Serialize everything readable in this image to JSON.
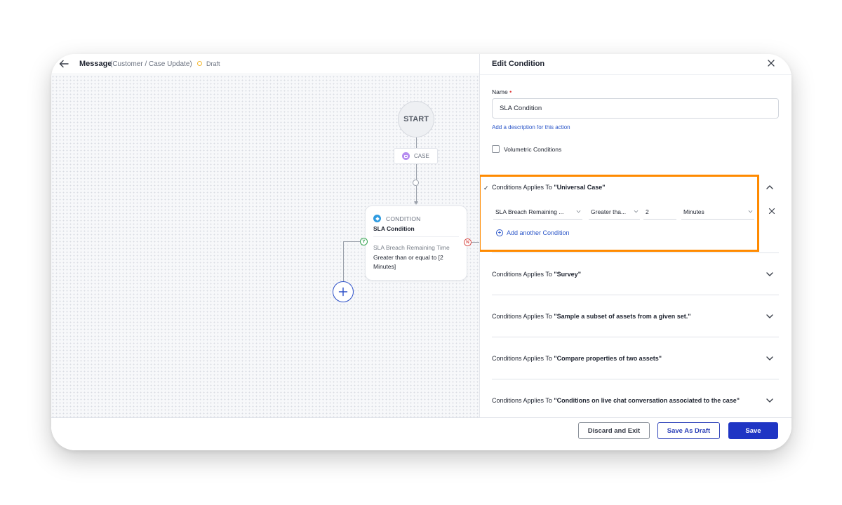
{
  "header": {
    "title": "Message",
    "subtitle": "(Customer / Case Update)",
    "status": "Draft",
    "status_color": "#f5b82e"
  },
  "canvas": {
    "start_label": "START",
    "case_label": "CASE",
    "condition_node": {
      "type": "CONDITION",
      "name": "SLA Condition",
      "field": "SLA Breach Remaining Time",
      "operator_text": "Greater than or equal to [2 Minutes]",
      "yes_label": "Y",
      "no_label": "N"
    }
  },
  "panel": {
    "title": "Edit Condition",
    "name_label": "Name",
    "name_value": "SLA Condition",
    "description_link": "Add a description for this action",
    "volumetric_label": "Volumetric Conditions",
    "volumetric_checked": false,
    "sections": [
      {
        "prefix": "Conditions Applies To ",
        "target": "\"Universal Case\"",
        "expanded": true,
        "rows": [
          {
            "field": "SLA Breach Remaining ...",
            "operator": "Greater tha...",
            "value": "2",
            "unit": "Minutes"
          }
        ],
        "add_label": "Add another Condition"
      },
      {
        "prefix": "Conditions Applies To ",
        "target": "\"Survey\"",
        "expanded": false
      },
      {
        "prefix": "Conditions Applies To ",
        "target": "\"Sample a subset of assets from a given set.\"",
        "expanded": false
      },
      {
        "prefix": "Conditions Applies To ",
        "target": "\"Compare properties of two assets\"",
        "expanded": false
      },
      {
        "prefix": "Conditions Applies To ",
        "target": "\"Conditions on live chat conversation associated to the case\"",
        "expanded": false
      }
    ]
  },
  "footer": {
    "discard_label": "Discard and Exit",
    "draft_label": "Save As Draft",
    "save_label": "Save"
  },
  "colors": {
    "primary": "#1f35c4",
    "link": "#2b56c8",
    "highlight": "#ff8a00",
    "yes": "#3aa655",
    "no": "#d9534f"
  }
}
